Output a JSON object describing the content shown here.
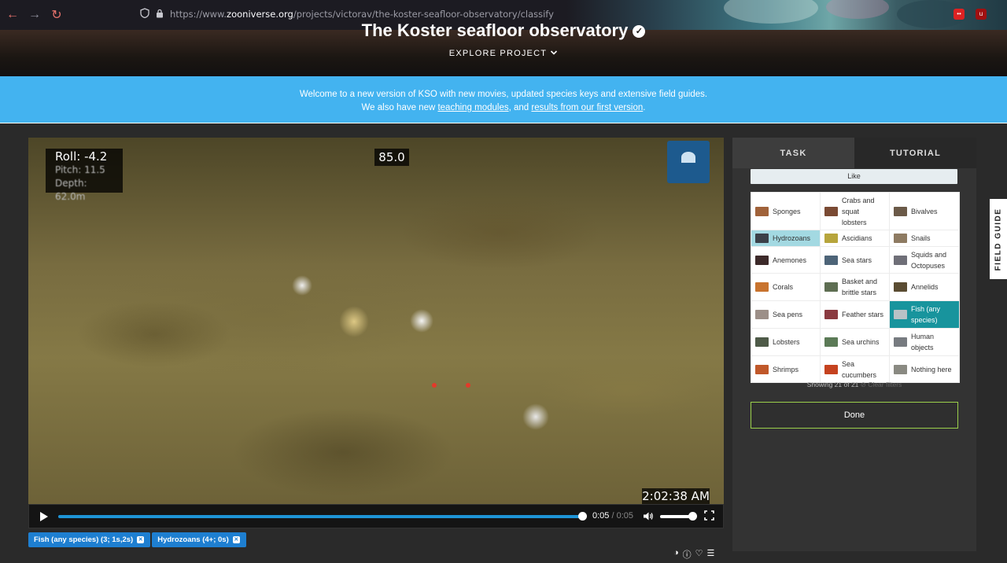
{
  "browser": {
    "url_prefix": "https://www.",
    "url_host": "zooniverse.org",
    "url_path": "/projects/victorav/the-koster-seafloor-observatory/classify"
  },
  "project": {
    "title": "The Koster seafloor observatory",
    "explore_label": "EXPLORE PROJECT"
  },
  "announcement": {
    "line1": "Welcome to a new version of KSO with new movies, updated species keys and extensive field guides.",
    "line2_prefix": "We also have new ",
    "link1": "teaching modules",
    "line2_mid": ", and ",
    "link2": "results from our first version",
    "line2_suffix": "."
  },
  "video": {
    "roll": "Roll: -4.2",
    "pitch": "Pitch: 11.5",
    "depth": "Depth: 62.0m",
    "heading": "85.0",
    "timestamp": "2:02:38 AM",
    "current_time": "0:05",
    "time_sep": "/",
    "duration": "0:05",
    "progress": 1.0,
    "volume": 0.85
  },
  "tags": [
    {
      "label": "Fish (any species) (3; 1s,2s)"
    },
    {
      "label": "Hydrozoans (4+; 0s)"
    }
  ],
  "panel": {
    "tab_task": "TASK",
    "tab_tutorial": "TUTORIAL",
    "like_label": "Like",
    "showing": "Showing 21 of 21",
    "clear_filters": "Clear filters",
    "done_label": "Done",
    "field_guide": "FIELD GUIDE"
  },
  "species": [
    {
      "label": "Sponges",
      "color": "#a0623a",
      "state": ""
    },
    {
      "label": "Crabs and squat lobsters",
      "color": "#7a4a33",
      "state": ""
    },
    {
      "label": "Bivalves",
      "color": "#6b5a48",
      "state": ""
    },
    {
      "label": "Hydrozoans",
      "color": "#3b4048",
      "state": "selected"
    },
    {
      "label": "Ascidians",
      "color": "#b7a53c",
      "state": ""
    },
    {
      "label": "Snails",
      "color": "#8e7b62",
      "state": ""
    },
    {
      "label": "Anemones",
      "color": "#3d2a2a",
      "state": ""
    },
    {
      "label": "Sea stars",
      "color": "#4d6478",
      "state": ""
    },
    {
      "label": "Squids and Octopuses",
      "color": "#6f6f78",
      "state": ""
    },
    {
      "label": "Corals",
      "color": "#c8732e",
      "state": ""
    },
    {
      "label": "Basket and brittle stars",
      "color": "#5e6e52",
      "state": ""
    },
    {
      "label": "Annelids",
      "color": "#5a4c32",
      "state": ""
    },
    {
      "label": "Sea pens",
      "color": "#9c8f88",
      "state": ""
    },
    {
      "label": "Feather stars",
      "color": "#8a3a40",
      "state": ""
    },
    {
      "label": "Fish (any species)",
      "color": "#b8c2c6",
      "state": "active"
    },
    {
      "label": "Lobsters",
      "color": "#4e5a48",
      "state": ""
    },
    {
      "label": "Sea urchins",
      "color": "#5b7a56",
      "state": ""
    },
    {
      "label": "Human objects",
      "color": "#777b80",
      "state": ""
    },
    {
      "label": "Shrimps",
      "color": "#c0582a",
      "state": ""
    },
    {
      "label": "Sea cucumbers",
      "color": "#c5421f",
      "state": ""
    },
    {
      "label": "Nothing here",
      "color": "#8a8a82",
      "state": ""
    }
  ],
  "icons": [
    "back-arrow-icon",
    "forward-arrow-icon",
    "reload-icon",
    "shield-icon",
    "lock-icon",
    "chevron-down-icon",
    "verified-check-icon",
    "play-icon",
    "volume-icon",
    "fullscreen-icon",
    "contrast-icon",
    "info-icon",
    "heart-icon",
    "list-icon",
    "close-icon",
    "clear-icon"
  ],
  "colors": {
    "accent_blue": "#43b3f0",
    "progress_blue": "#1e94d6",
    "tag_blue": "#1e7fd1",
    "teal_selected": "#18949d",
    "light_selected": "#a3d9e2",
    "done_border": "#9bd04b",
    "page_bg": "#2a2a2a"
  }
}
